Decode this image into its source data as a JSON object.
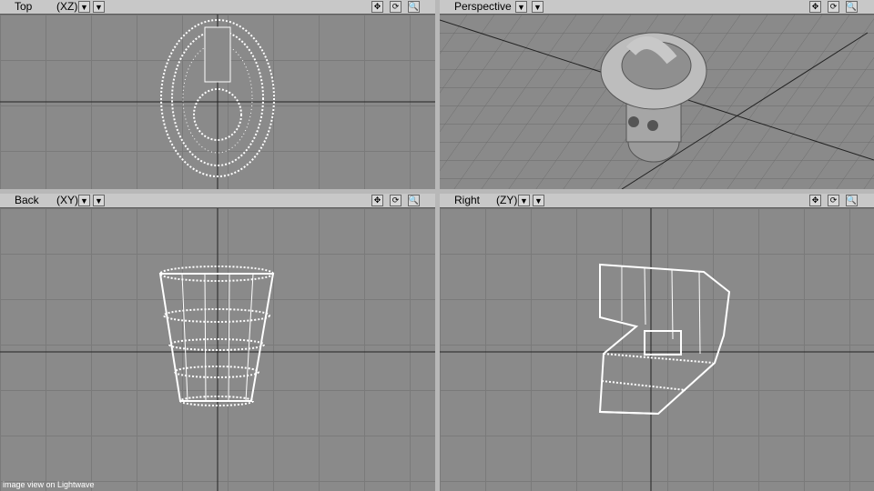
{
  "viewports": {
    "top": {
      "title": "Top",
      "axis": "(XZ)"
    },
    "perspective": {
      "title": "Perspective"
    },
    "back": {
      "title": "Back",
      "axis": "(XY)"
    },
    "right": {
      "title": "Right",
      "axis": "(ZY)"
    }
  },
  "icons": {
    "menu": "dropdown-arrow-icon",
    "move": "move-icon",
    "rotate": "rotate-icon",
    "zoom": "magnifier-icon"
  },
  "footer": {
    "caption": "image view on Lightwave"
  }
}
